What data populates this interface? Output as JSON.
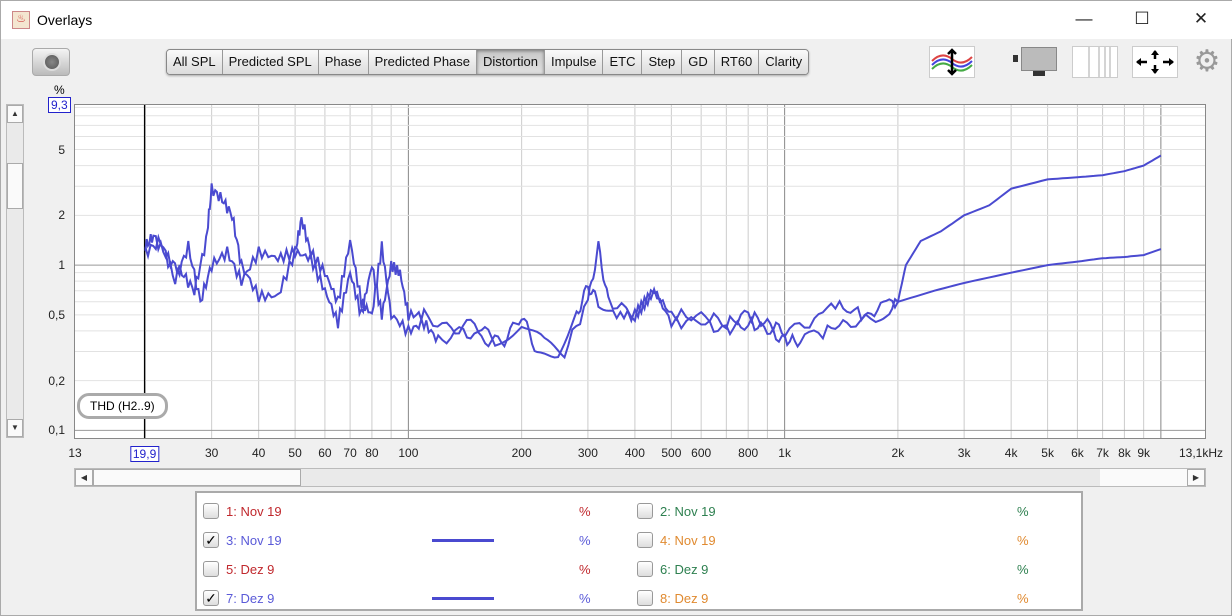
{
  "window": {
    "title": "Overlays",
    "controls": {
      "minimize": "—",
      "maximize": "☐",
      "close": "✕"
    }
  },
  "toolbar": {
    "tabs": [
      "All SPL",
      "Predicted SPL",
      "Phase",
      "Predicted Phase",
      "Distortion",
      "Impulse",
      "ETC",
      "Step",
      "GD",
      "RT60",
      "Clarity"
    ],
    "active": "Distortion"
  },
  "chart_data": {
    "type": "line",
    "title": "",
    "xlabel": "Hz",
    "ylabel": "%",
    "xscale": "log",
    "yscale": "log",
    "xlim": [
      13,
      13100
    ],
    "ylim": [
      0.09,
      9.3
    ],
    "x_ticks": [
      "13",
      "30",
      "40",
      "50",
      "60",
      "70",
      "80",
      "100",
      "200",
      "300",
      "400",
      "500",
      "600",
      "800",
      "1k",
      "2k",
      "3k",
      "4k",
      "5k",
      "6k",
      "7k",
      "8k",
      "9k",
      "13,1kHz"
    ],
    "x_tick_values": [
      13,
      30,
      40,
      50,
      60,
      70,
      80,
      100,
      200,
      300,
      400,
      500,
      600,
      800,
      1000,
      2000,
      3000,
      4000,
      5000,
      6000,
      7000,
      8000,
      9000,
      13100
    ],
    "y_ticks": [
      "5",
      "2",
      "1",
      "0,5",
      "0,2",
      "0,1"
    ],
    "y_tick_values": [
      5,
      2,
      1,
      0.5,
      0.2,
      0.1
    ],
    "y_unit": "%",
    "y_max_label": "9,3",
    "cursor_label": "19,9",
    "cursor_x": 19.9,
    "annotation": "THD (H2..9)",
    "series": [
      {
        "name": "3: Nov 19",
        "color": "#4a4ad0",
        "points": [
          [
            20,
            1.3
          ],
          [
            21,
            1.5
          ],
          [
            23,
            1.1
          ],
          [
            25,
            0.9
          ],
          [
            27,
            0.7
          ],
          [
            29,
            1.4
          ],
          [
            30,
            2.9
          ],
          [
            32,
            2.5
          ],
          [
            34,
            2.0
          ],
          [
            36,
            1.0
          ],
          [
            40,
            0.65
          ],
          [
            45,
            0.65
          ],
          [
            50,
            1.2
          ],
          [
            52,
            1.9
          ],
          [
            55,
            1.2
          ],
          [
            60,
            0.9
          ],
          [
            65,
            0.6
          ],
          [
            70,
            1.4
          ],
          [
            75,
            0.6
          ],
          [
            80,
            0.5
          ],
          [
            85,
            1.3
          ],
          [
            90,
            0.5
          ],
          [
            100,
            0.4
          ],
          [
            110,
            0.45
          ],
          [
            120,
            0.35
          ],
          [
            140,
            0.4
          ],
          [
            160,
            0.35
          ],
          [
            180,
            0.35
          ],
          [
            200,
            0.5
          ],
          [
            220,
            0.3
          ],
          [
            250,
            0.3
          ],
          [
            280,
            0.5
          ],
          [
            300,
            0.75
          ],
          [
            320,
            0.6
          ],
          [
            350,
            0.5
          ],
          [
            400,
            0.5
          ],
          [
            450,
            0.7
          ],
          [
            500,
            0.45
          ],
          [
            600,
            0.45
          ],
          [
            700,
            0.4
          ],
          [
            800,
            0.45
          ],
          [
            900,
            0.4
          ],
          [
            1000,
            0.35
          ],
          [
            1100,
            0.35
          ],
          [
            1300,
            0.4
          ],
          [
            1500,
            0.45
          ],
          [
            1800,
            0.5
          ],
          [
            2000,
            0.6
          ],
          [
            2100,
            1.0
          ],
          [
            2300,
            1.4
          ],
          [
            2600,
            1.6
          ],
          [
            3000,
            2.0
          ],
          [
            3500,
            2.3
          ],
          [
            4000,
            2.9
          ],
          [
            5000,
            3.3
          ],
          [
            6000,
            3.4
          ],
          [
            7000,
            3.5
          ],
          [
            8000,
            3.7
          ],
          [
            9000,
            4.0
          ],
          [
            10000,
            4.6
          ]
        ]
      },
      {
        "name": "7: Dez 9",
        "color": "#4a4ad0",
        "points": [
          [
            20,
            1.2
          ],
          [
            22,
            1.4
          ],
          [
            24,
            0.8
          ],
          [
            26,
            1.3
          ],
          [
            28,
            0.6
          ],
          [
            30,
            1.0
          ],
          [
            33,
            1.2
          ],
          [
            36,
            0.8
          ],
          [
            40,
            1.2
          ],
          [
            45,
            1.1
          ],
          [
            50,
            1.2
          ],
          [
            55,
            1.1
          ],
          [
            60,
            0.7
          ],
          [
            65,
            0.45
          ],
          [
            70,
            0.9
          ],
          [
            75,
            0.5
          ],
          [
            80,
            1.0
          ],
          [
            85,
            0.5
          ],
          [
            90,
            1.0
          ],
          [
            95,
            0.9
          ],
          [
            100,
            0.5
          ],
          [
            110,
            0.5
          ],
          [
            130,
            0.4
          ],
          [
            150,
            0.45
          ],
          [
            170,
            0.35
          ],
          [
            200,
            0.4
          ],
          [
            230,
            0.35
          ],
          [
            260,
            0.3
          ],
          [
            300,
            0.6
          ],
          [
            320,
            1.3
          ],
          [
            340,
            0.6
          ],
          [
            400,
            0.5
          ],
          [
            450,
            0.7
          ],
          [
            500,
            0.5
          ],
          [
            600,
            0.5
          ],
          [
            700,
            0.45
          ],
          [
            800,
            0.5
          ],
          [
            900,
            0.45
          ],
          [
            1000,
            0.4
          ],
          [
            1200,
            0.45
          ],
          [
            1400,
            0.6
          ],
          [
            1600,
            0.5
          ],
          [
            1800,
            0.55
          ],
          [
            2000,
            0.6
          ],
          [
            2500,
            0.7
          ],
          [
            3000,
            0.78
          ],
          [
            4000,
            0.9
          ],
          [
            5000,
            1.0
          ],
          [
            6000,
            1.05
          ],
          [
            7000,
            1.1
          ],
          [
            8000,
            1.12
          ],
          [
            9000,
            1.15
          ],
          [
            10000,
            1.25
          ]
        ]
      }
    ]
  },
  "legend": {
    "unit": "%",
    "items": [
      {
        "label": "1: Nov 19",
        "checked": false,
        "color": "#c0282d"
      },
      {
        "label": "2: Nov 19",
        "checked": false,
        "color": "#2e8050"
      },
      {
        "label": "3: Nov 19",
        "checked": true,
        "color": "#5a5ad8"
      },
      {
        "label": "4: Nov 19",
        "checked": false,
        "color": "#e08a30"
      },
      {
        "label": "5: Dez 9",
        "checked": false,
        "color": "#c0282d"
      },
      {
        "label": "6: Dez 9",
        "checked": false,
        "color": "#2e8050"
      },
      {
        "label": "7: Dez 9",
        "checked": true,
        "color": "#5a5ad8"
      },
      {
        "label": "8: Dez 9",
        "checked": false,
        "color": "#e08a30"
      }
    ]
  }
}
